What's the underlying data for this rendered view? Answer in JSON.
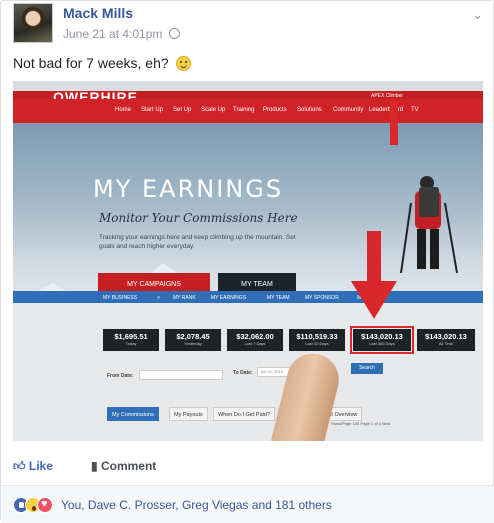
{
  "post": {
    "author": "Mack Mills",
    "timestamp": "June 21 at 4:01pm",
    "privacy_icon": "globe-icon",
    "text": "Not bad for 7 weeks, eh?",
    "emoji": "smiley-icon",
    "menu_icon": "chevron-down-icon"
  },
  "photo": {
    "logo": "OWERHIRE",
    "user_label": "APEX Climber",
    "nav": [
      "Home",
      "Start Up",
      "Set Up",
      "Scale Up",
      "Training",
      "Products",
      "Solutions",
      "Community",
      "Leaderboard",
      "TV"
    ],
    "hero_title": "MY EARNINGS",
    "hero_subtitle": "Monitor Your Commissions Here",
    "hero_desc": "Tracking your earnings here and keep climbing up the mountain. Set goals and reach higher everyday.",
    "btn_campaigns": "MY CAMPAIGNS",
    "btn_team": "MY TEAM",
    "subnav": [
      "MY BUSINESS",
      ">",
      "MY RANK",
      "MY EARNINGS",
      "MY TEAM",
      "MY SPONSOR",
      "MY"
    ],
    "stats": [
      {
        "value": "$1,695.51",
        "label": "Today"
      },
      {
        "value": "$2,078.45",
        "label": "Yesterday"
      },
      {
        "value": "$32,062.00",
        "label": "Last 7 Days"
      },
      {
        "value": "$110,519.33",
        "label": "Last 30 Days"
      },
      {
        "value": "$143,020.13",
        "label": "Last 365 Days"
      },
      {
        "value": "$143,020.13",
        "label": "All Time"
      }
    ],
    "from_date_label": "From Date:",
    "to_date_label": "To Date:",
    "to_date_value": "Jun 21, 2016",
    "search_label": "Search",
    "tabs": [
      "My Commissions",
      "My Payouts",
      "When Do I Get Paid?",
      "Product Overview"
    ],
    "rows_label": "Rows/Page",
    "rows_value": "100",
    "page_label": "Page",
    "page_value": "1",
    "page_of": "of 6",
    "next_label": "Next"
  },
  "actions": {
    "like_label": "Like",
    "comment_label": "Comment"
  },
  "reactions": {
    "text": "You, Dave C. Prosser, Greg Viegas and 181 others"
  },
  "colors": {
    "link": "#365899",
    "brand_red": "#c51f24",
    "brand_blue": "#2f6fb7",
    "reaction_bar": "#f6f7f9"
  }
}
